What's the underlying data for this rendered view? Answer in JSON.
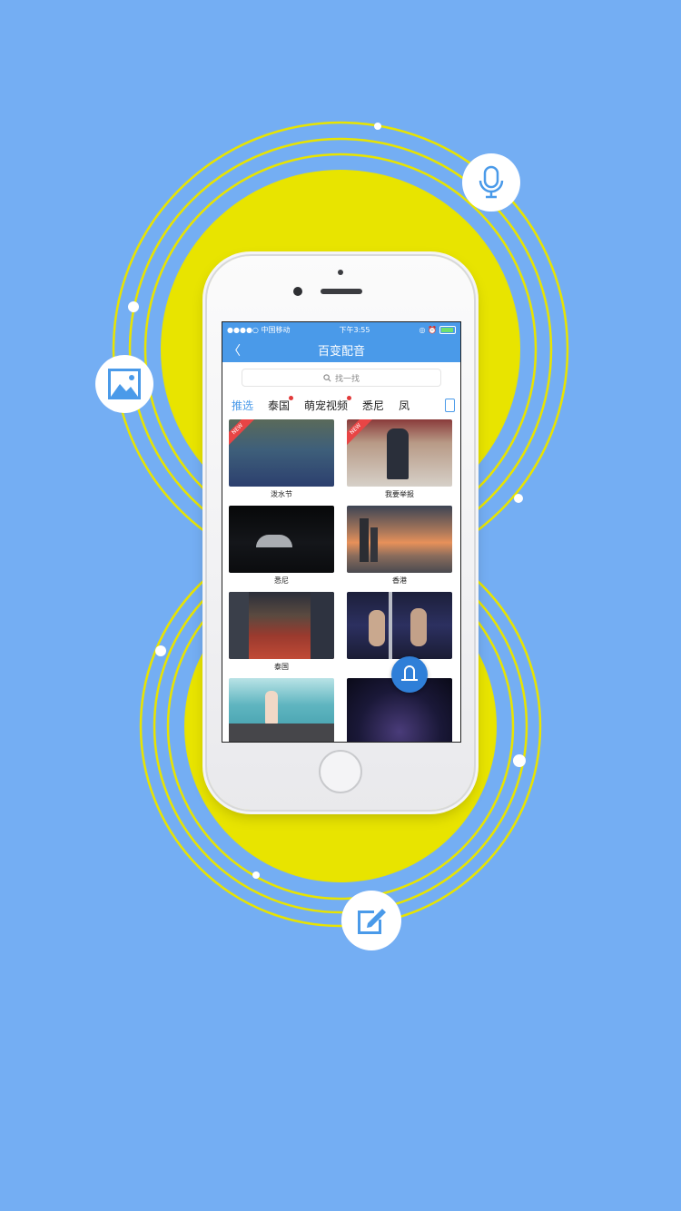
{
  "colors": {
    "background": "#74aef3",
    "yellow": "#e8e400",
    "accent": "#4a9ae9",
    "badge": "#e23a3a"
  },
  "floating_icons": [
    "microphone-icon",
    "image-icon",
    "edit-icon"
  ],
  "status_bar": {
    "carrier": "●●●●○ 中国移动",
    "time": "下午3:55",
    "right": "◎ ⏰"
  },
  "nav": {
    "back_symbol": "〈",
    "title": "百变配音"
  },
  "search": {
    "placeholder": "找一找"
  },
  "tabs": [
    {
      "label": "推选",
      "active": true,
      "badge": false
    },
    {
      "label": "泰国",
      "active": false,
      "badge": true
    },
    {
      "label": "萌宠视频",
      "active": false,
      "badge": true
    },
    {
      "label": "悉尼",
      "active": false,
      "badge": false
    },
    {
      "label": "凤",
      "active": false,
      "badge": false
    }
  ],
  "videos": [
    {
      "caption": "泼水节",
      "new": true
    },
    {
      "caption": "我要举报",
      "new": true
    },
    {
      "caption": "悉尼",
      "new": false
    },
    {
      "caption": "香港",
      "new": false
    },
    {
      "caption": "泰国",
      "new": false
    },
    {
      "caption": "",
      "new": false
    },
    {
      "caption": "",
      "new": false
    },
    {
      "caption": "",
      "new": false
    }
  ],
  "new_tag": "NEW"
}
